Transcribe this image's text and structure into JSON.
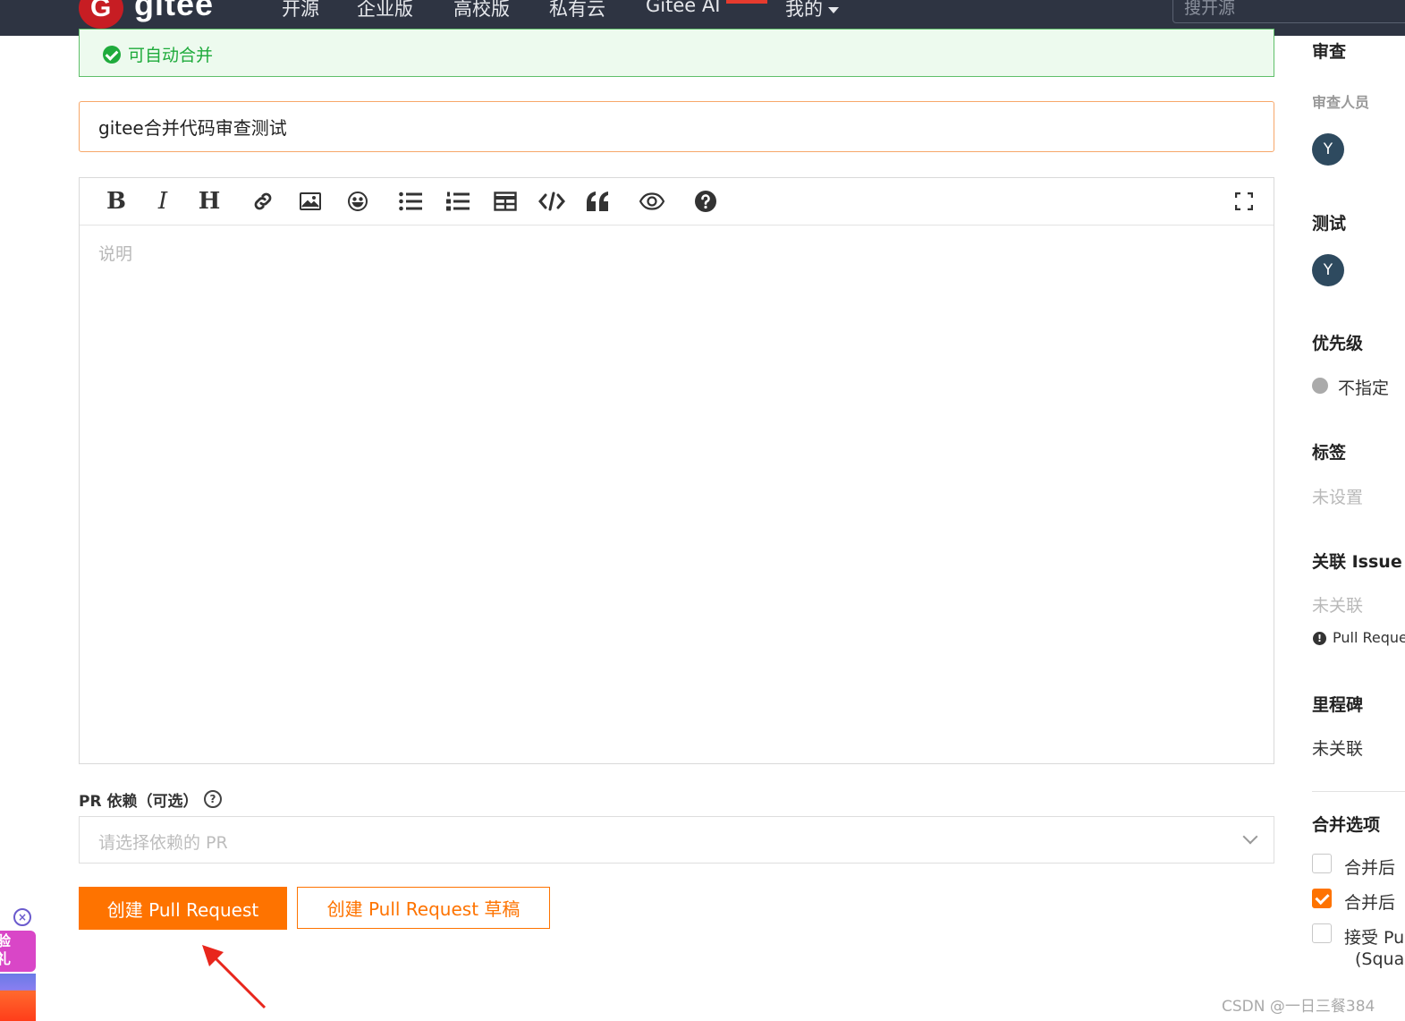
{
  "nav": {
    "logo_letter": "G",
    "logo_text": "gitee",
    "items": [
      "开源",
      "企业版",
      "高校版",
      "私有云",
      "Gitee AI",
      "我的"
    ],
    "search_placeholder": "搜开源"
  },
  "form": {
    "merge_status": "可自动合并",
    "title_value": "gitee合并代码审查测试",
    "description_placeholder": "说明",
    "toolbar_icons": [
      "bold-icon",
      "italic-icon",
      "heading-icon",
      "link-icon",
      "image-icon",
      "emoji-icon",
      "bullet-list-icon",
      "numbered-list-icon",
      "table-icon",
      "code-icon",
      "quote-icon",
      "preview-icon",
      "help-icon",
      "fullscreen-icon"
    ],
    "toolbar_letters": {
      "bold": "B",
      "italic": "I",
      "heading": "H"
    },
    "pr_dependency_label": "PR 依赖（可选）",
    "pr_dependency_help": "?",
    "pr_dependency_placeholder": "请选择依赖的 PR",
    "create_button": "创建 Pull Request",
    "create_draft_button": "创建 Pull Request 草稿"
  },
  "sidebar": {
    "review_heading": "审查",
    "reviewers_label": "审查人员",
    "reviewer_avatar": "Y",
    "test_heading": "测试",
    "tester_avatar": "Y",
    "priority_heading": "优先级",
    "priority_value": "不指定",
    "labels_heading": "标签",
    "labels_value": "未设置",
    "issue_heading": "关联 Issue",
    "issue_value": "未关联",
    "issue_note": "Pull Reque",
    "issue_note_icon": "!",
    "milestone_heading": "里程碑",
    "milestone_value": "未关联",
    "merge_options_heading": "合并选项",
    "merge_options": [
      {
        "label": "合并后",
        "checked": false
      },
      {
        "label": "合并后",
        "checked": true
      },
      {
        "label": "接受 Pu",
        "checked": false
      }
    ],
    "merge_option_sub": "(Squa"
  },
  "promo": {
    "close_icon": "×",
    "text_line1": "验",
    "text_line2": "礼"
  },
  "watermark": "CSDN @一日三餐384",
  "colors": {
    "nav_bg": "#2e3442",
    "accent": "#fe7300",
    "success": "#1fab3c",
    "brand_red": "#c71d23"
  }
}
